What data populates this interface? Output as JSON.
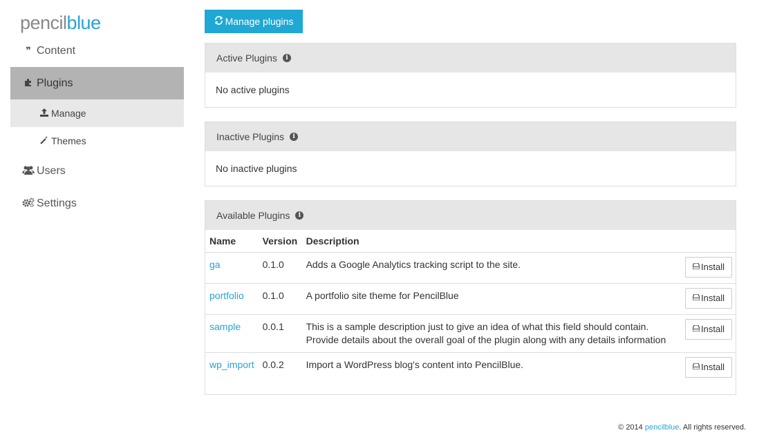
{
  "logo": {
    "part1": "pencil",
    "part2": "blue"
  },
  "sidebar": {
    "items": [
      {
        "label": "Content",
        "icon": "quote-icon"
      },
      {
        "label": "Plugins",
        "icon": "puzzle-icon"
      },
      {
        "label": "Manage",
        "icon": "upload-icon"
      },
      {
        "label": "Themes",
        "icon": "magic-wand-icon"
      },
      {
        "label": "Users",
        "icon": "users-icon"
      },
      {
        "label": "Settings",
        "icon": "cogs-icon"
      }
    ]
  },
  "toolbar": {
    "manage_label": "Manage plugins"
  },
  "panels": {
    "active": {
      "title": "Active Plugins",
      "empty": "No active plugins"
    },
    "inactive": {
      "title": "Inactive Plugins",
      "empty": "No inactive plugins"
    },
    "available": {
      "title": "Available Plugins",
      "columns": [
        "Name",
        "Version",
        "Description"
      ],
      "rows": [
        {
          "name": "ga",
          "version": "0.1.0",
          "description": "Adds a Google Analytics tracking script to the site.",
          "action": "Install"
        },
        {
          "name": "portfolio",
          "version": "0.1.0",
          "description": "A portfolio site theme for PencilBlue",
          "action": "Install"
        },
        {
          "name": "sample",
          "version": "0.0.1",
          "description": "This is a sample description just to give an idea of what this field should contain. Provide details about the overall goal of the plugin along with any details information",
          "action": "Install"
        },
        {
          "name": "wp_import",
          "version": "0.0.2",
          "description": "Import a WordPress blog's content into PencilBlue.",
          "action": "Install"
        }
      ]
    }
  },
  "footer": {
    "prefix": "© 2014 ",
    "link": "pencilblue",
    "suffix": ". All rights reserved."
  },
  "colors": {
    "accent": "#1fa8d4",
    "link": "#29a3d1",
    "active_nav": "#b3b3b3",
    "active_subnav": "#e8e8e8"
  }
}
